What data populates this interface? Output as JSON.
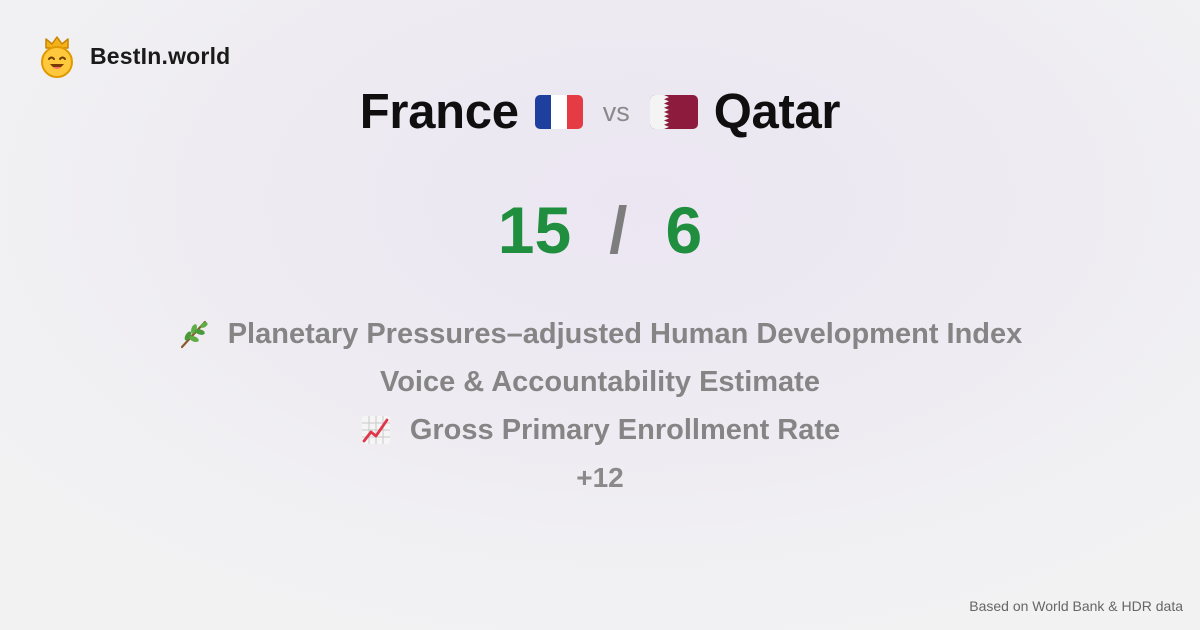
{
  "brand": {
    "name": "BestIn.world",
    "logo_icon": "crowned-smiley-icon"
  },
  "comparison": {
    "left": {
      "name": "France",
      "flag_icon": "france-flag-icon",
      "score": "15"
    },
    "vs_label": "vs",
    "right": {
      "name": "Qatar",
      "flag_icon": "qatar-flag-icon",
      "score": "6"
    },
    "separator": "/",
    "score_color": "#1f8f3f"
  },
  "metrics": [
    {
      "icon": "leaf-branch-icon",
      "label": "Planetary Pressures–adjusted Human Development Index"
    },
    {
      "icon": "",
      "label": "Voice & Accountability Estimate"
    },
    {
      "icon": "chart-increasing-icon",
      "label": "Gross Primary Enrollment Rate"
    }
  ],
  "more_label": "+12",
  "footer": {
    "source": "Based on World Bank & HDR data"
  }
}
